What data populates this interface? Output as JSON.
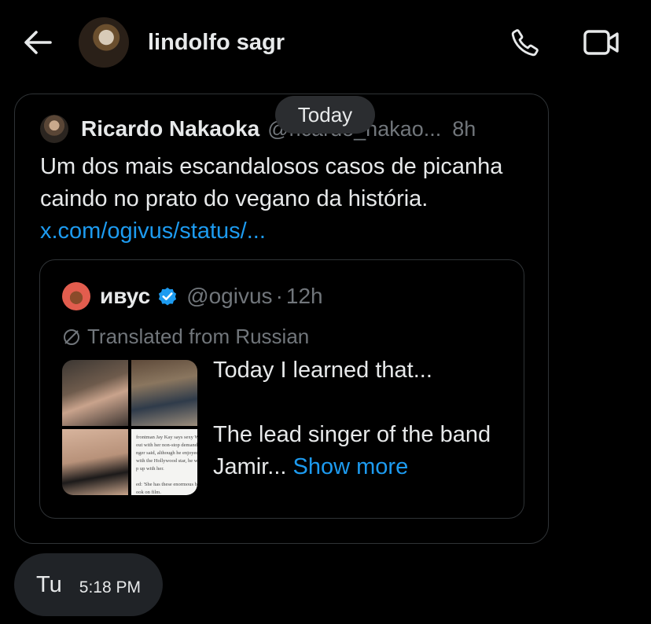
{
  "header": {
    "contact_name": "lindolfo sagr",
    "icons": {
      "back": "arrow-left-icon",
      "call": "phone-icon",
      "video": "video-camera-icon"
    }
  },
  "date_separator": "Today",
  "shared_tweet": {
    "author_name": "Ricardo Nakaoka",
    "author_handle": "@ricardo_nakao...",
    "time": "8h",
    "text": "Um dos mais escandalosos casos de picanha caindo no prato do vegano da história.",
    "link_text": "x.com/ogivus/status/..."
  },
  "quoted_tweet": {
    "author_name": "ивус",
    "author_handle": "@ogivus",
    "separator": "·",
    "time": "12h",
    "translated_label": "Translated from Russian",
    "text_line1": "Today I learned that...",
    "text_line2": "The lead singer of the band Jamir...",
    "show_more": "Show more",
    "media_caption_snippet": "frontman Jay Kay says sexy Winona\nout with her non-stop demands for\nnger said, although he enjoyed his\nwith the Hollywood star, he was le\np up with her.\n\ned: 'She has these enormous breas\nook on film.\n\nve this habit of constantly wantin\ns. It was exhausting.'"
  },
  "message": {
    "text": "Tu",
    "time": "5:18 PM"
  },
  "colors": {
    "background": "#000000",
    "text": "#e7e9ea",
    "muted": "#71767b",
    "link": "#1d9bf0",
    "border": "#2f3336",
    "bubble": "#202327"
  }
}
